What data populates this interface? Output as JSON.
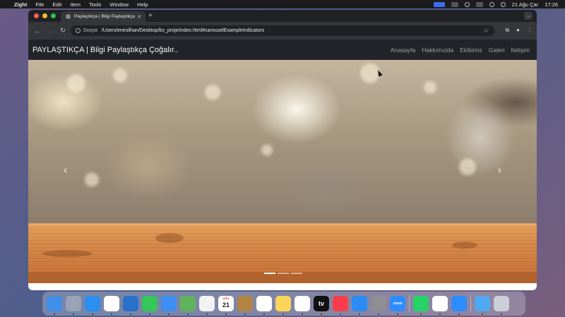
{
  "menubar": {
    "app_name": "Zight",
    "menus": [
      "File",
      "Edit",
      "Item",
      "Tools",
      "Window",
      "Help"
    ],
    "date": "21 Ağu Çar",
    "time": "17:26"
  },
  "browser": {
    "tab_title": "Paylaştıkça | Bilgi Paylaştıkça",
    "url_chip": "Dosya",
    "url": "/Users/enesilhan/Desktop/bs_proje/index.html#carouselExampleIndicators"
  },
  "site": {
    "brand": "PAYLAŞTIKÇA | Bilgi Paylaştıkça Çoğalır..",
    "nav": [
      "Anasayfa",
      "Hakkımızda",
      "Ekibimiz",
      "Galeri",
      "İletişim"
    ]
  },
  "carousel": {
    "slide_count": 3,
    "active_slide": 1
  },
  "dock": {
    "apps": [
      {
        "name": "finder-icon",
        "color": "#3f8fe8"
      },
      {
        "name": "launchpad-icon",
        "color": "#9aa3b5"
      },
      {
        "name": "safari-icon",
        "color": "#2b8ff0"
      },
      {
        "name": "opera-icon",
        "color": "#ffffff"
      },
      {
        "name": "vscode-icon",
        "color": "#2a6fc9"
      },
      {
        "name": "messages-icon",
        "color": "#34c759"
      },
      {
        "name": "mail-icon",
        "color": "#3d8ef5"
      },
      {
        "name": "maps-icon",
        "color": "#5fb35a"
      },
      {
        "name": "photos-icon",
        "color": "#f2f2f2"
      },
      {
        "name": "calendar-icon",
        "color": "#ffffff",
        "label_top": "AĞU",
        "label": "21"
      },
      {
        "name": "notes-app-icon",
        "color": "#b28443"
      },
      {
        "name": "reminders-icon",
        "color": "#ffffff"
      },
      {
        "name": "notes-icon",
        "color": "#fbd45c"
      },
      {
        "name": "freeform-icon",
        "color": "#ffffff"
      },
      {
        "name": "appletv-icon",
        "color": "#111111",
        "label": "tv"
      },
      {
        "name": "music-icon",
        "color": "#fa3c4c"
      },
      {
        "name": "appstore-icon",
        "color": "#2a8cf4"
      },
      {
        "name": "system-settings-icon",
        "color": "#8e8e93"
      },
      {
        "name": "zoom-icon",
        "color": "#2d8cff",
        "label": "zoom"
      },
      {
        "name": "whatsapp-icon",
        "color": "#25d366"
      },
      {
        "name": "chrome-icon",
        "color": "#ffffff"
      },
      {
        "name": "zoom-meetings-icon",
        "color": "#2d8cff"
      },
      {
        "name": "downloads-folder-icon",
        "color": "#4fa8f0"
      },
      {
        "name": "trash-icon",
        "color": "#c9ced8"
      }
    ]
  }
}
